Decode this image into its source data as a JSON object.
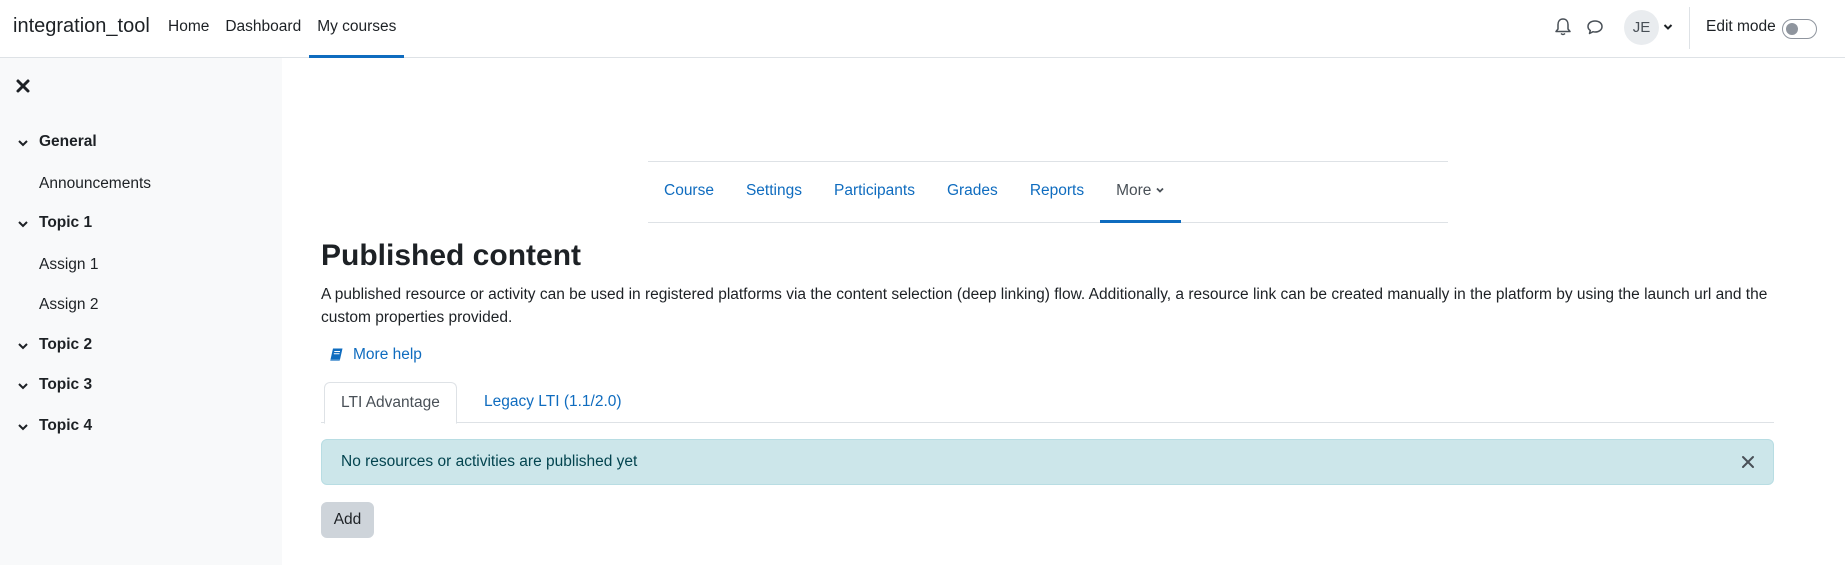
{
  "navbar": {
    "brand": "integration_tool",
    "links": [
      {
        "label": "Home",
        "active": false
      },
      {
        "label": "Dashboard",
        "active": false
      },
      {
        "label": "My courses",
        "active": true
      }
    ],
    "icons": [
      "bell-icon",
      "chat-icon"
    ],
    "avatar_initials": "JE",
    "edit_mode_label": "Edit mode",
    "edit_mode_on": false
  },
  "drawer": {
    "close_icon": "close-icon",
    "sections": [
      {
        "title": "General",
        "activities": [
          "Announcements"
        ]
      },
      {
        "title": "Topic 1",
        "activities": [
          "Assign 1",
          "Assign 2"
        ]
      },
      {
        "title": "Topic 2",
        "activities": []
      },
      {
        "title": "Topic 3",
        "activities": []
      },
      {
        "title": "Topic 4",
        "activities": []
      }
    ]
  },
  "secondary_nav": {
    "items": [
      {
        "label": "Course",
        "active": false
      },
      {
        "label": "Settings",
        "active": false
      },
      {
        "label": "Participants",
        "active": false
      },
      {
        "label": "Grades",
        "active": false
      },
      {
        "label": "Reports",
        "active": false
      },
      {
        "label": "More",
        "active": true
      }
    ]
  },
  "main": {
    "heading": "Published content",
    "intro": "A published resource or activity can be used in registered platforms via the content selection (deep linking) flow. Additionally, a resource link can be created manually in the platform by using the launch url and the custom properties provided.",
    "help_link": "More help",
    "tabs": [
      {
        "label": "LTI Advantage",
        "active": true
      },
      {
        "label": "Legacy LTI (1.1/2.0)",
        "active": false
      }
    ],
    "alert": "No resources or activities are published yet",
    "add_button": "Add"
  },
  "colors": {
    "link": "#0f6cbf",
    "alert_bg": "#cce6ea",
    "alert_text": "#03444f",
    "drawer_bg": "#f8f9fa",
    "button_bg": "#ced4da"
  }
}
